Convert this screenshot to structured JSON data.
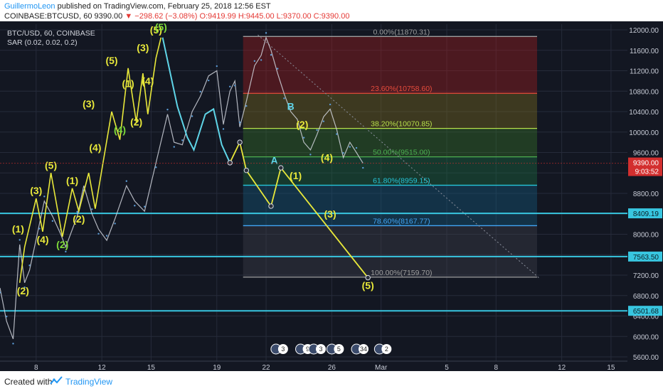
{
  "header": {
    "author": "GuillermoLeon",
    "published": "published on TradingView.com, February 25, 2018 12:56 EST",
    "symbol_line_prefix": "COINBASE:BTCUSD, 60 9390.00",
    "change": "▼ −298.62 (−3.08%)",
    "ohlc": "O:9419.99 H:9445.00 L:9370.00 C:9390.00"
  },
  "chart_title": "BTC/USD, 60, COINBASE",
  "indicator": "SAR (0.02, 0.02, 0.2)",
  "footer": {
    "created_with": "Created with",
    "brand": "TradingView"
  },
  "colors": {
    "background": "#131722",
    "grid": "#262b3a",
    "wave": "#e8e83a",
    "wave_count": "#7fdc3a",
    "correction": "#5fd5e8",
    "hline": "#38c6e0",
    "axis_text": "#c7cbd6",
    "price_tag": "#d32f2f"
  },
  "chart_data": {
    "type": "line",
    "y_axis_ticks": [
      12000,
      11600,
      11200,
      10800,
      10400,
      10000,
      9600,
      9200,
      8800,
      8400,
      8000,
      7600,
      7200,
      6800,
      6400,
      6000,
      5600
    ],
    "y_axis_labels": [
      "12000.00",
      "11600.00",
      "11200.00",
      "10800.00",
      "10400.00",
      "10000.00",
      "9600.00",
      "9200.00",
      "8800.00",
      "8400.00",
      "8000.00",
      "7600.00",
      "7200.00",
      "6800.00",
      "6400.00",
      "6000.00",
      "5600.00"
    ],
    "ylim": [
      5600,
      12000
    ],
    "x_axis_ticks": [
      8,
      12,
      15,
      19,
      22,
      26,
      29,
      33,
      36,
      40,
      43
    ],
    "x_axis_labels": [
      "8",
      "12",
      "15",
      "19",
      "22",
      "26",
      "Mar",
      "5",
      "8",
      "12",
      "15"
    ],
    "xlim": [
      5.8,
      44
    ],
    "current_price": {
      "value": 9390,
      "label": "9390.00",
      "countdown": "9:03:52"
    },
    "horizontal_levels": [
      {
        "value": 8409.19,
        "label": "8409.19"
      },
      {
        "value": 7563.5,
        "label": "7563.50"
      },
      {
        "value": 6501.68,
        "label": "6501.68"
      }
    ],
    "fib_levels": [
      {
        "ratio": "0.00%",
        "value": 11870.31,
        "label": "0.00%(11870.31)",
        "color": "#9e9e9e"
      },
      {
        "ratio": "23.60%",
        "value": 10758.6,
        "label": "23.60%(10758.60)",
        "color": "#e74c3c"
      },
      {
        "ratio": "38.20%",
        "value": 10070.85,
        "label": "38.20%(10070.85)",
        "color": "#b7e04a"
      },
      {
        "ratio": "50.00%",
        "value": 9515.0,
        "label": "50.00%(9515.00)",
        "color": "#4caf50"
      },
      {
        "ratio": "61.80%",
        "value": 8959.15,
        "label": "61.80%(8959.15)",
        "color": "#26c6da"
      },
      {
        "ratio": "78.60%",
        "value": 8167.77,
        "label": "78.60%(8167.77)",
        "color": "#42a5f5"
      },
      {
        "ratio": "100.00%",
        "value": 7159.7,
        "label": "100.00%(7159.70)",
        "color": "#9e9e9e"
      }
    ],
    "fib_range_x": [
      20.6,
      38.5
    ],
    "price_path": [
      [
        5.8,
        6950
      ],
      [
        6.2,
        6300
      ],
      [
        6.6,
        5950
      ],
      [
        7,
        7800
      ],
      [
        7.3,
        7050
      ],
      [
        7.6,
        7300
      ],
      [
        8.2,
        8200
      ],
      [
        8.5,
        8650
      ],
      [
        9,
        8350
      ],
      [
        9.5,
        8000
      ],
      [
        9.8,
        7750
      ],
      [
        10.5,
        8350
      ],
      [
        10.9,
        8950
      ],
      [
        11.4,
        8400
      ],
      [
        11.8,
        8100
      ],
      [
        12.3,
        7880
      ],
      [
        12.8,
        8300
      ],
      [
        13.5,
        8950
      ],
      [
        14,
        8650
      ],
      [
        14.6,
        8450
      ],
      [
        15.3,
        9400
      ],
      [
        16,
        10350
      ],
      [
        16.4,
        9800
      ],
      [
        16.9,
        9750
      ],
      [
        17.5,
        10400
      ],
      [
        18,
        10700
      ],
      [
        18.5,
        11100
      ],
      [
        19,
        11200
      ],
      [
        19.4,
        10150
      ],
      [
        19.8,
        10800
      ],
      [
        20.1,
        11000
      ],
      [
        20.4,
        10100
      ],
      [
        20.8,
        10600
      ],
      [
        21.3,
        11300
      ],
      [
        21.7,
        11500
      ],
      [
        22,
        11850
      ],
      [
        22.3,
        11600
      ],
      [
        22.7,
        11150
      ],
      [
        23.1,
        10750
      ],
      [
        23.5,
        10400
      ],
      [
        23.9,
        10250
      ],
      [
        24.3,
        9800
      ],
      [
        24.7,
        9650
      ],
      [
        25.1,
        9950
      ],
      [
        25.5,
        10300
      ],
      [
        25.9,
        10450
      ],
      [
        26.3,
        10050
      ],
      [
        26.7,
        9500
      ],
      [
        27.1,
        9800
      ],
      [
        27.5,
        9600
      ],
      [
        27.9,
        9390
      ]
    ],
    "wave_path": [
      [
        7.0,
        7050
      ],
      [
        7.3,
        7750
      ],
      [
        8.0,
        8700
      ],
      [
        8.4,
        8050
      ],
      [
        8.9,
        9200
      ],
      [
        9.6,
        7950
      ],
      [
        10.2,
        8900
      ],
      [
        10.6,
        8450
      ],
      [
        11.2,
        9200
      ],
      [
        11.6,
        8500
      ],
      [
        12.6,
        10400
      ],
      [
        13.1,
        9850
      ],
      [
        13.6,
        11250
      ],
      [
        14.1,
        10200
      ],
      [
        14.5,
        11150
      ],
      [
        14.8,
        10350
      ],
      [
        15.3,
        11450
      ],
      [
        15.6,
        11850
      ]
    ],
    "wave_labels": [
      {
        "text": "(1)",
        "x": 6.9,
        "y": 7950,
        "pos": "above",
        "color": "wave"
      },
      {
        "text": "(2)",
        "x": 7.2,
        "y": 7050,
        "pos": "below",
        "color": "wave"
      },
      {
        "text": "(3)",
        "x": 8.0,
        "y": 8700,
        "pos": "above",
        "color": "wave"
      },
      {
        "text": "(4)",
        "x": 8.4,
        "y": 8050,
        "pos": "below",
        "color": "wave"
      },
      {
        "text": "(5)",
        "x": 8.9,
        "y": 9200,
        "pos": "above",
        "color": "wave"
      },
      {
        "text": "(2)",
        "x": 9.6,
        "y": 7950,
        "pos": "below",
        "color": "wave_count"
      },
      {
        "text": "(1)",
        "x": 10.2,
        "y": 8900,
        "pos": "above",
        "color": "wave"
      },
      {
        "text": "(2)",
        "x": 10.6,
        "y": 8450,
        "pos": "below",
        "color": "wave"
      },
      {
        "text": "(3)",
        "x": 11.2,
        "y": 10400,
        "pos": "above",
        "color": "wave"
      },
      {
        "text": "(4)",
        "x": 11.6,
        "y": 9850,
        "pos": "below",
        "color": "wave"
      },
      {
        "text": "(5)",
        "x": 12.6,
        "y": 11250,
        "pos": "above",
        "color": "wave"
      },
      {
        "text": "(4)",
        "x": 13.1,
        "y": 10200,
        "pos": "below",
        "color": "wave_count"
      },
      {
        "text": "(1)",
        "x": 13.6,
        "y": 10800,
        "pos": "above",
        "color": "wave"
      },
      {
        "text": "(2)",
        "x": 14.1,
        "y": 10350,
        "pos": "below",
        "color": "wave"
      },
      {
        "text": "(3)",
        "x": 14.5,
        "y": 11500,
        "pos": "above",
        "color": "wave"
      },
      {
        "text": "(4)",
        "x": 14.8,
        "y": 11150,
        "pos": "below",
        "color": "wave"
      },
      {
        "text": "(5)",
        "x": 15.3,
        "y": 11850,
        "pos": "above",
        "color": "wave"
      },
      {
        "text": "(5)",
        "x": 15.6,
        "y": 11900,
        "pos": "above",
        "color": "wave_count"
      },
      {
        "text": "A",
        "x": 22.5,
        "y": 9600,
        "pos": "below",
        "color": "correction"
      },
      {
        "text": "B",
        "x": 23.5,
        "y": 10350,
        "pos": "above",
        "color": "correction"
      },
      {
        "text": "(2)",
        "x": 24.2,
        "y": 10000,
        "pos": "above",
        "color": "wave"
      },
      {
        "text": "(1)",
        "x": 23.8,
        "y": 9300,
        "pos": "below",
        "color": "wave"
      },
      {
        "text": "(4)",
        "x": 25.7,
        "y": 9350,
        "pos": "above",
        "color": "wave"
      },
      {
        "text": "(3)",
        "x": 25.9,
        "y": 8550,
        "pos": "below",
        "color": "wave"
      },
      {
        "text": "(5)",
        "x": 28.2,
        "y": 7150,
        "pos": "below",
        "color": "wave"
      }
    ],
    "correction_path": [
      [
        15.7,
        11850
      ],
      [
        16.6,
        10500
      ],
      [
        17.2,
        9900
      ],
      [
        17.6,
        9650
      ],
      [
        18.3,
        10350
      ],
      [
        18.8,
        10450
      ],
      [
        19.3,
        9750
      ],
      [
        19.8,
        9400
      ]
    ],
    "projection_path": [
      [
        19.8,
        9400
      ],
      [
        20.4,
        9800
      ],
      [
        20.8,
        9250
      ],
      [
        22.3,
        8550
      ],
      [
        22.9,
        9300
      ],
      [
        28.2,
        7150
      ]
    ],
    "events": [
      "3",
      "9",
      "3",
      "5",
      "34",
      "2"
    ]
  }
}
